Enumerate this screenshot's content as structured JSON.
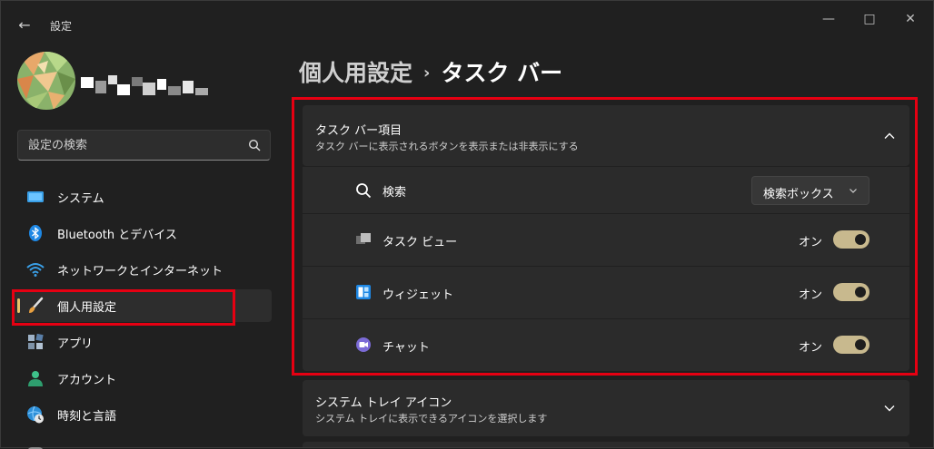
{
  "window": {
    "title": "設定",
    "back_icon": "arrow-left-icon",
    "controls": [
      "minimize-icon",
      "maximize-icon",
      "close-icon"
    ]
  },
  "search": {
    "placeholder": "設定の検索",
    "icon": "search-icon"
  },
  "sidebar": {
    "items": [
      {
        "label": "システム",
        "icon": "monitor-icon"
      },
      {
        "label": "Bluetooth とデバイス",
        "icon": "bluetooth-icon"
      },
      {
        "label": "ネットワークとインターネット",
        "icon": "wifi-icon"
      },
      {
        "label": "個人用設定",
        "icon": "brush-icon",
        "selected": true
      },
      {
        "label": "アプリ",
        "icon": "apps-icon"
      },
      {
        "label": "アカウント",
        "icon": "person-icon"
      },
      {
        "label": "時刻と言語",
        "icon": "globe-clock-icon"
      }
    ]
  },
  "breadcrumb": {
    "parent": "個人用設定",
    "separator": "›",
    "current": "タスク バー"
  },
  "taskbar_items": {
    "title": "タスク バー項目",
    "subtitle": "タスク バーに表示されるボタンを表示または非表示にする",
    "expanded": true,
    "rows": [
      {
        "label": "検索",
        "icon": "search-icon",
        "control": "dropdown",
        "value": "検索ボックス"
      },
      {
        "label": "タスク ビュー",
        "icon": "task-view-icon",
        "control": "toggle",
        "state": "オン",
        "on": true
      },
      {
        "label": "ウィジェット",
        "icon": "widgets-icon",
        "control": "toggle",
        "state": "オン",
        "on": true
      },
      {
        "label": "チャット",
        "icon": "chat-icon",
        "control": "toggle",
        "state": "オン",
        "on": true
      }
    ]
  },
  "system_tray": {
    "title": "システム トレイ アイコン",
    "subtitle": "システム トレイに表示できるアイコンを選択します",
    "expanded": false
  },
  "colors": {
    "background": "#202020",
    "card": "#2b2b2b",
    "accent": "#c8b98e",
    "selection_bar": "#e8c36a",
    "highlight_box": "#e60012"
  }
}
